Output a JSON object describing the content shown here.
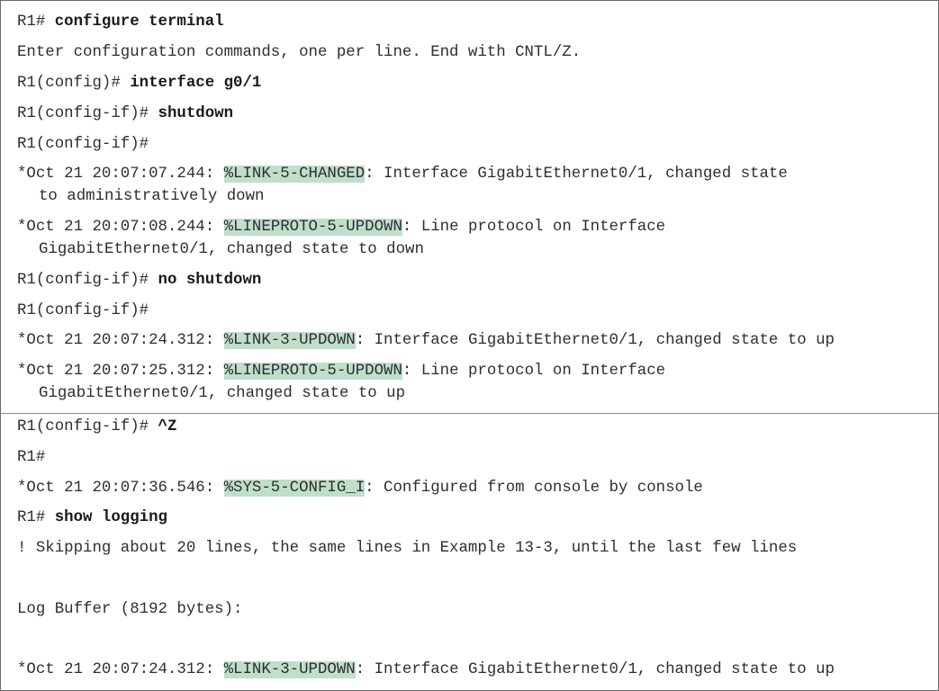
{
  "lines": [
    {
      "prompt": "R1# ",
      "command": "configure terminal"
    },
    {
      "text": "Enter configuration commands, one per line. End with CNTL/Z."
    },
    {
      "prompt": "R1(config)# ",
      "command": "interface g0/1"
    },
    {
      "prompt": "R1(config-if)# ",
      "command": "shutdown"
    },
    {
      "prompt": "R1(config-if)#"
    },
    {
      "pre": "*Oct 21 20:07:07.244: ",
      "tag": "%LINK-5-CHANGED",
      "post": ": Interface GigabitEthernet0/1, changed state",
      "cont": "to administratively down"
    },
    {
      "pre": "*Oct 21 20:07:08.244: ",
      "tag": "%LINEPROTO-5-UPDOWN",
      "post": ": Line protocol on Interface",
      "cont": "GigabitEthernet0/1, changed state to down"
    },
    {
      "prompt": "R1(config-if)# ",
      "command": "no shutdown"
    },
    {
      "prompt": "R1(config-if)#"
    },
    {
      "pre": "*Oct 21 20:07:24.312: ",
      "tag": "%LINK-3-UPDOWN",
      "post": ": Interface GigabitEthernet0/1, changed state to up"
    },
    {
      "pre": "*Oct 21 20:07:25.312: ",
      "tag": "%LINEPROTO-5-UPDOWN",
      "post": ": Line protocol on Interface",
      "cont": "GigabitEthernet0/1, changed state to up"
    },
    {
      "prompt": "R1(config-if)# ",
      "command": "^Z"
    },
    {
      "prompt": "R1#"
    },
    {
      "pre": "*Oct 21 20:07:36.546: ",
      "tag": "%SYS-5-CONFIG_I",
      "post": ": Configured from console by console"
    },
    {
      "prompt": "R1# ",
      "command": "show logging"
    },
    {
      "text": "! Skipping about 20 lines, the same lines in Example 13-3, until the last few lines"
    },
    {
      "text": "Log Buffer (8192 bytes):"
    },
    {
      "pre": "*Oct 21 20:07:24.312: ",
      "tag": "%LINK-3-UPDOWN",
      "post": ": Interface GigabitEthernet0/1, changed state to up"
    }
  ],
  "colors": {
    "highlight": "#bfdfca",
    "text": "#2f2f2f",
    "border": "#6b6b6b"
  }
}
